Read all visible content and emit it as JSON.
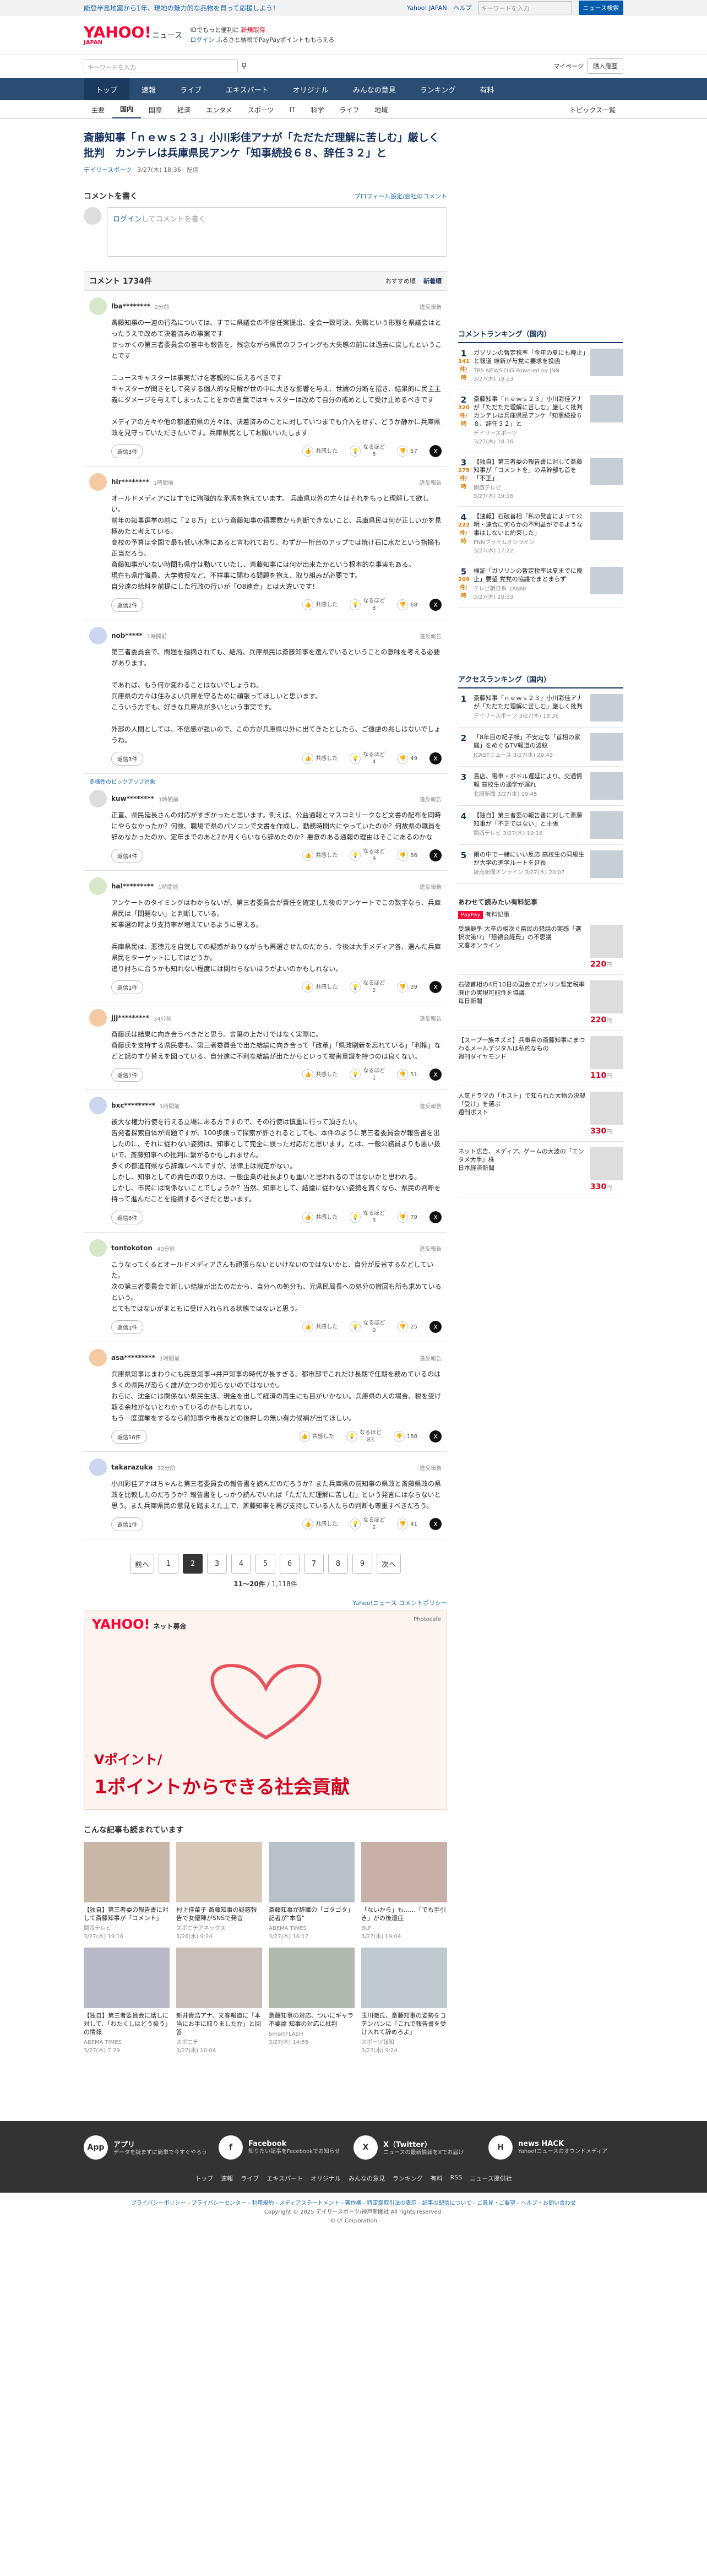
{
  "topbar": {
    "promo": "能登半島地震から1年、現地の魅力的な品物を買って応援しよう！",
    "links": [
      "Yahoo! JAPAN",
      "ヘルプ"
    ],
    "search_placeholder": "キーワードを入力",
    "search_button": "ニュース検索"
  },
  "header": {
    "logo": "YAHOO!",
    "logo_sub": "JAPAN",
    "logo_service": "ニュース",
    "line1_pre": "IDでもっと便利に",
    "line1_link": "新規取得",
    "line2_login": "ログイン",
    "line2_text": "ふるさと納税でPayPayポイントももらえる"
  },
  "subsearch": {
    "placeholder": "キーワードを入力",
    "mypage": "マイページ",
    "buy": "購入履歴"
  },
  "mainnav": [
    "トップ",
    "速報",
    "ライブ",
    "エキスパート",
    "オリジナル",
    "みんなの意見",
    "ランキング",
    "有料"
  ],
  "subnav": [
    "主要",
    "国内",
    "国際",
    "経済",
    "エンタメ",
    "スポーツ",
    "IT",
    "科学",
    "ライフ",
    "地域"
  ],
  "subnav_right": "トピックス一覧",
  "article": {
    "title": "斎藤知事「ｎｅｗｓ２３」小川彩佳アナが「ただただ理解に苦しむ」厳しく批判　カンテレは兵庫県民アンケ「知事続投６８、辞任３２」と",
    "source": "デイリースポーツ",
    "date": "3/27(木) 18:36",
    "dist": "配信"
  },
  "comment_form": {
    "heading": "コメントを書く",
    "link": "プロフィール設定/会社のコメント",
    "login": "ログイン",
    "placeholder": "してコメントを書く"
  },
  "comments_head": {
    "count": "コメント 1734件",
    "sort": [
      "おすすめ順",
      "新着順"
    ]
  },
  "labels": {
    "report": "違反報告",
    "reply": "返信",
    "like": "共感した",
    "dislike": "なるほど",
    "x": "X"
  },
  "comments": [
    {
      "user": "lba********",
      "time": "2分前",
      "body": "斎藤知事の一連の行為については、すでに県議会の不信任案提出、全会一致可決、失職という形態を県議会はとったうえで改めて決着済みの事案です\nせっかくの第三者委員会の答申も報告を、残念ながら県民のフライングも大失態の前には過去に戻したということです\n\nニュースキャスターは事実だけを客観的に伝えるべきです\nキャスターが聞きをして発する個人的な見解が世の中に大きな影響を与え、世論の分断を招き、結果的に民主主義にダメージを与えてしまったことをかの言葉ではキャスターは改めて自分の戒めとして受け止めるべきです\n\nメディアの方々や他の都道府県の方々は、決着済みのことに対していつまでも介入をせず、どうか静かに兵庫県政を見守っていただきたいです。兵庫県民としてお願いいたします",
      "likes": "47",
      "hmm": "5",
      "disagree": "57",
      "replies": "返信3件"
    },
    {
      "user": "hir********",
      "time": "1時間前",
      "body": "オールドメディアにはすでに殉職的な矛盾を抱えています。 兵庫県以外の方々はそれをもっと理解して欲しい。\n前年の知事選挙の前に「２８万」という斎藤知事の得票数から判断できないこと、兵庫県民は何が正しいかを見極めたと考えている。\n高校の予算は全国で最も低い水準にあると言われており、わずか一桁台のアップでは焼け石に水だという指摘も正当だろう。\n斎藤知事がいない時間も県庁は動いていたし、斎藤知事には何が出来たかという根本的な事実もある。\n現在も県庁職員、大学教授など、不祥事に関わる問題を抱え、取り組みが必要です。\n自分達の給料を前提にした行政の行いが「O8連合」とは大違いです！",
      "likes": "185",
      "hmm": "8",
      "disagree": "68",
      "replies": "返信2件"
    },
    {
      "user": "nob*****",
      "time": "1時間前",
      "body": "第三者委員会で、問題を指摘されても、結局、兵庫県民は斎藤知事を選んでいるということの意味を考える必要があります。\n\nであれば、もう何か変わることはないでしょうね。\n兵庫県の方々は住みよい兵庫を守るために頑張ってほしいと思います。\nこういう方でも、好きな兵庫県が多いという事実です。\n\n外部の人間としては、不信感が強いので、この方が兵庫県以外に出てきたとしたら、ご遠慮の兆しはないでしょうね。",
      "likes": "69",
      "hmm": "4",
      "disagree": "49",
      "replies": "返信3件"
    },
    {
      "user": "kuw********",
      "time": "1時間前",
      "pickup": "多様性のピックアップ対象",
      "body": "正直、県民延長さんの対応がすぎかったと思います。例えば、公益通報とマスコミリークなど文書の配布を同時にやらなかったか？何故、職場で県のパソコンで文書を作成し、勤務時間内にやっていたのか？何故県の職員を辞めなかったのか、定年までのあと2か月くらいなら辞めたのか？悪意のある通報の理由はそこにあるのかな",
      "likes": "95",
      "hmm": "9",
      "disagree": "86",
      "replies": "返信4件"
    },
    {
      "user": "hal*********",
      "time": "1時間前",
      "body": "アンケートのタイミングはわからないが、第三者委員会が責任を確定した後のアンケートでこの数字なら、兵庫県民は「問題ない」と判断している。\n知事選の時より支持率が増えているように思える。\n\n兵庫県民は、悪徳元を自覚しての疑惑がありながらも再選させたのだから、今後は大手メディア各、選んだ兵庫県民をターゲットにしてはどうか。\n追り討ちに合うかも知れない程度には関わらないほうがよいのかもしれない。",
      "likes": "80",
      "hmm": "2",
      "disagree": "39",
      "replies": "返信1件"
    },
    {
      "user": "jjj*********",
      "time": "34分前",
      "body": "斎藤氏は結果に向き合うべきだと思う。言葉の上だけではなく実際に。\n斎藤氏を支持する県民委も、第三者委員会で出た結論に向き合って「改革」「県政刷新を忘れている」「利権」などと話のすり替えを図っている。自分達に不利な結論が出たからといって被害意識を持つのは良くない。",
      "likes": "56",
      "hmm": "1",
      "disagree": "51",
      "replies": "返信1件"
    },
    {
      "user": "bxc*********",
      "time": "1時間前",
      "body": "被大な権力行使を行える立場にある方ですので、その行使は慎重に行って頂きたい。\n告発者探索自体が問題ですが、100歩譲って探索が許されるとしても、本件のように第三者委員会が報告書を出したのに、それに従わない姿勢は、知事として完全に誤った対応だと思います。とは、一般公務員よりも悪い扱いで、斎藤知事への批判に繋がるかもしれません。\n多くの都道府県なら辞職レベルですが、法律上は規定がない。\nしかし、知事としての責任の取り方は、一般企業の社長よりも重いと思われるのではないかと思われる。\nしかし、市民には関係ないことでしょうか？当然、知事として、結論に従わない姿勢を貫くなら、県民の判断を持って進んだことを指摘するべきだと思います。",
      "likes": "108",
      "hmm": "3",
      "disagree": "79",
      "replies": "返信6件"
    },
    {
      "user": "tontokoton",
      "time": "40分前",
      "body": "こうなってくるとオールドメディアさんも頑張らないといけないのではないかと、自分が反省するなどしていた。\n次の第三者委員会で新しい結論が出たのだから、自分への処分も、元県民局長への処分の撤回も所も求めているという。\nとてもではないがまともに受け入れられる状態ではないと思う。",
      "likes": "35",
      "hmm": "0",
      "disagree": "25",
      "replies": "返信1件"
    },
    {
      "user": "asa*********",
      "time": "1時間前",
      "body": "兵庫県知事はまわりにも民意知事→井戸知事の時代が長すぎる。都市部でこれだけ長期で任期を務めているのは多くの県民が恐らく誰が立つのか知らないのではないか。\nおらに、沈金には関係ない県民生活、現金を出して経済の再生にも目がいかない。兵庫県の人の場合、税を受け取る余地がないとわかっているのかもしれない。\nもう一度選挙をするなら前知事や市長などの後押しの無い有力候補が出てほしい。",
      "likes": "519",
      "hmm": "83",
      "disagree": "188",
      "replies": "返信16件"
    },
    {
      "user": "takarazuka",
      "time": "32分前",
      "body": "小川彩佳アナはちゃんと第三者委員会の報告書を読んだのだろうか？また兵庫県の前知事の県政と斎藤県政の県政を比較したのだろうか？報告書をしっかり読んでいれば「ただただ理解に苦しむ」という発言にはならないと思う。また兵庫県民の意見を踏まえた上で、斎藤知事を再び支持している人たちの判断も尊重すべきだろう。",
      "likes": "90",
      "hmm": "2",
      "disagree": "41",
      "replies": "返信1件"
    }
  ],
  "pager": {
    "prev": "前へ",
    "pages": [
      "1",
      "2",
      "3",
      "4",
      "5",
      "6",
      "7",
      "8",
      "9"
    ],
    "current": "2",
    "next": "次へ",
    "range": "11〜20件",
    "total": "/ 1,118件"
  },
  "yc_link": "Yahoo!ニュース コメントポリシー",
  "ad": {
    "brand": "YAHOO!",
    "brand_sub": "ネット募金",
    "pr": "Photocafe",
    "line1": "Vポイント/",
    "line2": "1ポイントからできる社会貢献"
  },
  "also": {
    "heading": "こんな記事も読まれています",
    "items": [
      {
        "title": "【独自】第三者委の報告書に対して斎藤知事が「コメント」",
        "src": "関西テレビ",
        "date": "3/27(木) 19:16"
      },
      {
        "title": "村上佳菜子 斎藤知事の疑惑報告で女優陣がSNSで発言",
        "src": "スポニチアネックス",
        "date": "3/26(水) 9:24"
      },
      {
        "title": "斎藤知事が辞職の「ゴタゴタ」記者が\"本音\"",
        "src": "ABEMA TIMES",
        "date": "3/27(木) 16:17"
      },
      {
        "title": "「ないから」も……「でも手引き」がの後遺症",
        "src": "BLF",
        "date": "3/27(木) 19:04"
      },
      {
        "title": "【独自】第三者委員会に話しに対して、「わたくしはどう扱う」の情報",
        "src": "ABEMA TIMES",
        "date": "3/27(木) 7:29"
      },
      {
        "title": "新井貴浩アナ、文春報道に「本当にお手に取りましたか」と回答",
        "src": "スポニチ",
        "date": "3/27(木) 10:04"
      },
      {
        "title": "斎藤知事の対応、ついにギャラ不要論 知事の対応に批判",
        "src": "SmartFLASH",
        "date": "3/27(木) 14:55"
      },
      {
        "title": "玉川徹氏、斎藤知事の姿勢をコテンパンに「これで報告書を受け入れて辞めろよ」",
        "src": "スポーツ報知",
        "date": "3/27(木) 9:24"
      }
    ]
  },
  "ranking": {
    "heading": "コメントランキング（国内）",
    "items": [
      {
        "no": "1",
        "count": "341",
        "unit": "件/時",
        "title": "ガソリンの暫定税率「今年の夏にも廃止」と報道 維新が与党に要求を投函",
        "src": "TBS NEWS DIG Powered by JNN",
        "date": "3/27(木) 18:13"
      },
      {
        "no": "2",
        "count": "320",
        "unit": "件/時",
        "title": "斎藤知事「ｎｅｗｓ２３」小川彩佳アナが「ただただ理解に苦しむ」厳しく批判　カンテレは兵庫県民アンケ「知事続投６８、辞任３２」と",
        "src": "デイリースポーツ",
        "date": "3/27(木) 18:36"
      },
      {
        "no": "3",
        "count": "275",
        "unit": "件/時",
        "title": "【独自】第三者委の報告書に対して斎藤知事が「コメントを」の県幹部も首を「不正」",
        "src": "関西テレビ",
        "date": "3/27(木) 19:16"
      },
      {
        "no": "4",
        "count": "222",
        "unit": "件/時",
        "title": "【速報】石破首相「私の発言によって公明・連合に何らかの不利益がでるような事はしないと約束した」",
        "src": "FNNプライムオンライン",
        "date": "3/27(木) 17:22"
      },
      {
        "no": "5",
        "count": "209",
        "unit": "件/時",
        "title": "検証「ガソリンの暫定税率は夏までに廃止」要望 党党の協議でまとまらず",
        "src": "テレビ朝日系（ANN）",
        "date": "3/27(木) 20:33"
      }
    ]
  },
  "access": {
    "heading": "アクセスランキング（国内）",
    "items": [
      {
        "no": "1",
        "title": "斎藤知事「ｎｅｗｓ２３」小川彩佳アナが「ただただ理解に苦しむ」厳しく批判",
        "src": "デイリースポーツ",
        "date": "3/27(木) 18:36"
      },
      {
        "no": "2",
        "title": "「8年目の紀子様」不安定な「首相の家庭」をめぐるTV報道の波紋",
        "src": "JCASTニュース",
        "date": "3/27(木) 20:43"
      },
      {
        "no": "3",
        "title": "島店、電車・ボドル遅延により、交通情報 高校生の通学が遅れ",
        "src": "北國新聞",
        "date": "3/27(木) 19:45"
      },
      {
        "no": "4",
        "title": "【独自】第三者委の報告書に対して斎藤知事が「不正ではない」と主張",
        "src": "関西テレビ",
        "date": "3/27(木) 19:16"
      },
      {
        "no": "5",
        "title": "雨の中で一緒にいい反応 高校生の同級生が大学の進学ルートを延長",
        "src": "読売新聞オンライン",
        "date": "3/27(木) 20:07"
      }
    ]
  },
  "paypay": {
    "heading": "あわせて読みたい有料記事",
    "logo": "PayPay",
    "sub": "有料記事",
    "items": [
      {
        "title": "受験競争 大卒の相次ぐ県民の懇話の実感「選択次第!?」「懇親会経費」の不思議",
        "src": "文春オンライン",
        "price": "220",
        "unit": "円"
      },
      {
        "title": "石破首相の4月10日の国会でガソリン暫定税率廃止の実現可能性を協議",
        "src": "毎日新聞",
        "price": "220",
        "unit": "円"
      },
      {
        "title": "【スープ一族ネズミ】兵庫県の斎藤知事にまつわるメールデジタルは私的なもの",
        "src": "週刊ダイヤモンド",
        "price": "110",
        "unit": "円"
      },
      {
        "title": "人気ドラマの「ホスト」で知られた大物の決裂「受け」を選ぶ",
        "src": "週刊ポスト",
        "price": "330",
        "unit": "円"
      },
      {
        "title": "ネット広告、メディア、ゲームの大波の「エンタメ大手」株",
        "src": "日本経済新聞",
        "price": "330",
        "unit": "円"
      }
    ]
  },
  "footer": {
    "items": [
      {
        "icon": "App",
        "title": "アプリ",
        "sub": "データを読まずに簡単で今すぐやろう"
      },
      {
        "icon": "f",
        "title": "Facebook",
        "sub": "知りたい記事をFacebookでお知らせ"
      },
      {
        "icon": "X",
        "title": "X（Twitter）",
        "sub": "ニュースの最新情報をXでお届け"
      },
      {
        "icon": "H",
        "title": "news HACK",
        "sub": "Yahoo!ニュースのオウンドメディア"
      }
    ],
    "links": [
      "トップ",
      "速報",
      "ライブ",
      "エキスパート",
      "オリジナル",
      "みんなの意見",
      "ランキング",
      "有料",
      "RSS",
      "ニュース提供社"
    ],
    "legal": "プライバシーポリシー - プライバシーセンター - 利用規約 - メディアステートメント - 著作権 - 特定商取引法の表示 - 記事の配信について - ご意見・ご要望 - ヘルプ・お問い合わせ",
    "copy1": "Copyright © 2025 デイリースポーツ/神戸新聞社 All rights reserved.",
    "copy2": "© LY Corporation"
  }
}
